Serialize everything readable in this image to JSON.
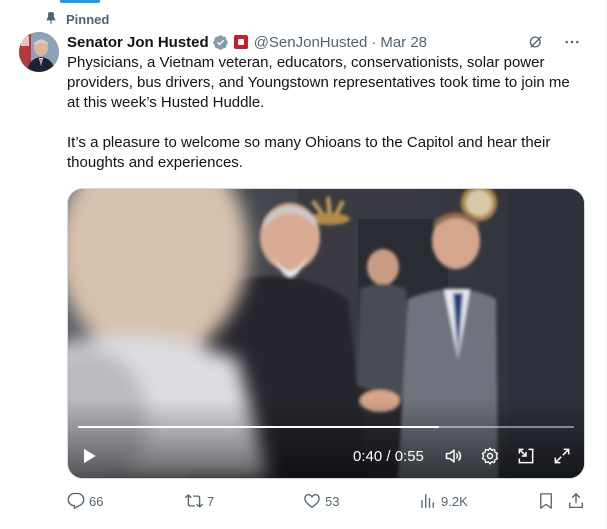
{
  "pinned_label": "Pinned",
  "author": {
    "name": "Senator Jon Husted",
    "handle": "@SenJonHusted",
    "separator": "·",
    "date": "Mar 28"
  },
  "body": {
    "paragraph1": "Physicians, a Vietnam veteran, educators, conservationists, solar power providers, bus drivers, and Youngstown representatives took time to join me at this week’s Husted Huddle.",
    "paragraph2": "It’s a pleasure to welcome so many Ohioans to the Capitol and hear their thoughts and experiences."
  },
  "video": {
    "time_display": "0:40 / 0:55",
    "progress": 0.727
  },
  "actions": {
    "replies": "66",
    "reposts": "7",
    "likes": "53",
    "views": "9.2K"
  },
  "colors": {
    "accent": "#1d9bf0",
    "muted": "#536471",
    "text": "#0f1419"
  }
}
